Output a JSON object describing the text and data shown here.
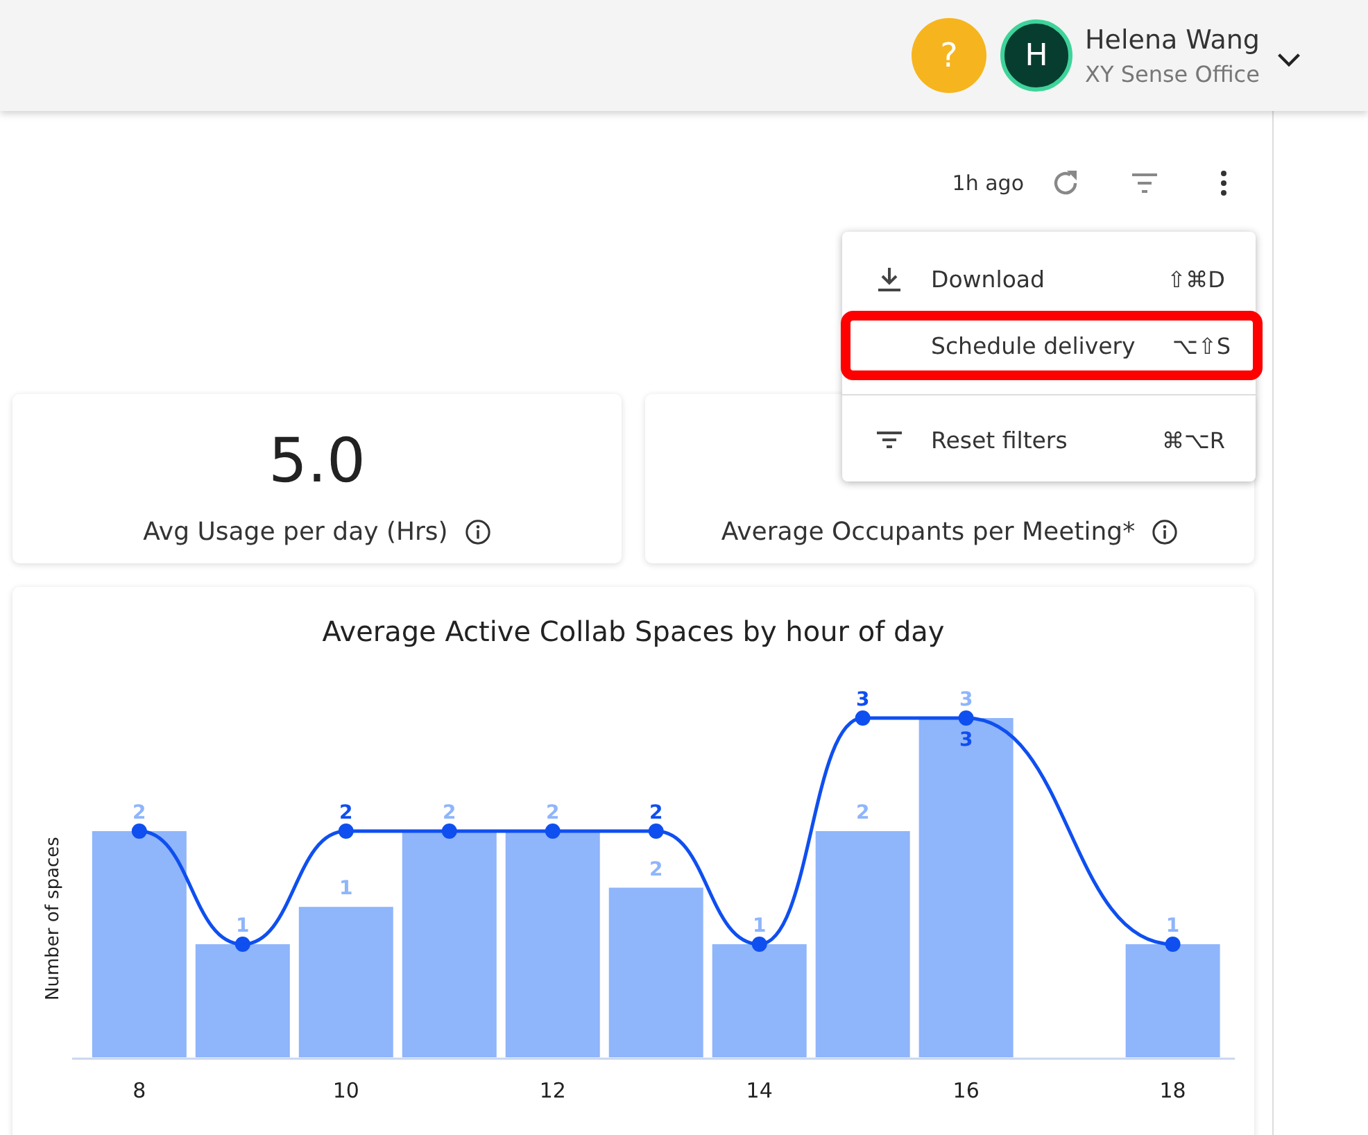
{
  "header": {
    "help": "?",
    "user": {
      "initial": "H",
      "name": "Helena Wang",
      "organization": "XY Sense Office"
    }
  },
  "toolbar": {
    "updated": "1h ago"
  },
  "menu": {
    "groups": [
      [
        {
          "kind": "download",
          "label": "Download",
          "shortcut": "⇧⌘D",
          "highlighted": false
        },
        {
          "kind": "plain",
          "label": "Schedule delivery",
          "shortcut": "⌥⇧S",
          "highlighted": true
        }
      ],
      [
        {
          "kind": "filter",
          "label": "Reset filters",
          "shortcut": "⌘⌥R",
          "highlighted": false
        }
      ]
    ]
  },
  "cards": [
    {
      "value": "5.0",
      "label": "Avg Usage per day (Hrs)"
    },
    {
      "label": "Average Occupants per Meeting*"
    }
  ],
  "chart": {
    "chart_data": {
      "type": "bar",
      "title": "Average Active Collab Spaces by hour of day",
      "ylabel": "Number of spaces",
      "x": [
        8,
        9,
        10,
        11,
        12,
        13,
        14,
        15,
        16,
        18
      ],
      "xlim": [
        7.35,
        18.6
      ],
      "xticks": [
        8,
        10,
        12,
        14,
        16,
        18
      ],
      "series": [
        {
          "type": "bar",
          "color": "#8fb5fb",
          "values": [
            2,
            1,
            1.33,
            2,
            2,
            1.5,
            1,
            2,
            3,
            1
          ],
          "value_labels": [
            "2",
            "1",
            "1",
            "2",
            "2",
            "2",
            "1",
            "2",
            "3",
            "1"
          ]
        },
        {
          "type": "line",
          "marker": "circle",
          "color": "#0f4ff0",
          "values": [
            2,
            1,
            2,
            2,
            2,
            2,
            1,
            3,
            3,
            1
          ],
          "value_labels": [
            null,
            null,
            "2",
            null,
            null,
            "2",
            null,
            "3",
            "3",
            null
          ]
        }
      ],
      "data_labels": true
    }
  }
}
